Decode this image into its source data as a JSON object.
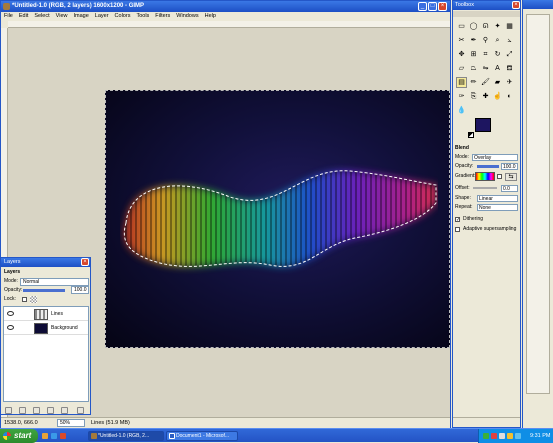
{
  "gimp": {
    "title": "*Untitled-1.0 (RGB, 2 layers) 1600x1200 - GIMP",
    "menus": [
      "File",
      "Edit",
      "Select",
      "View",
      "Image",
      "Layer",
      "Colors",
      "Tools",
      "Filters",
      "Windows",
      "Help"
    ],
    "status": {
      "coords": "1538.0, 666.0",
      "zoom": "50%",
      "message": "Lines (51.9 MB)"
    }
  },
  "layers": {
    "window_title": "Layers",
    "panel_title": "Layers",
    "mode_label": "Mode:",
    "mode_value": "Normal",
    "opacity_label": "Opacity:",
    "opacity_value": "100.0",
    "lock_label": "Lock:",
    "items": [
      {
        "name": "Lines",
        "visible": true
      },
      {
        "name": "Background",
        "visible": true
      }
    ]
  },
  "toolbox": {
    "title": "Toolbox",
    "fg_color": "#1d1560",
    "bg_color": "#000000",
    "options": {
      "tool_name": "Blend",
      "mode_label": "Mode:",
      "mode_value": "Overlay",
      "opacity_label": "Opacity:",
      "opacity_value": "100.0",
      "gradient_label": "Gradient:",
      "offset_label": "Offset:",
      "offset_value": "0.0",
      "shape_label": "Shape:",
      "shape_value": "Linear",
      "repeat_label": "Repeat:",
      "repeat_value": "None",
      "dithering_label": "Dithering",
      "dithering_checked": true,
      "adaptive_label": "Adaptive supersampling",
      "adaptive_checked": false
    }
  },
  "taskbar": {
    "start_label": "start",
    "tasks": [
      {
        "label": "*Untitled-1.0 (RGB, 2...",
        "active": true
      },
      {
        "label": "Document1 - Microsof...",
        "active": false
      }
    ],
    "clock": "9:31 PM"
  }
}
